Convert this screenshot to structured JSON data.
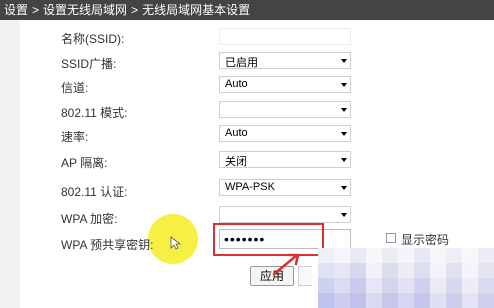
{
  "breadcrumb": {
    "items": [
      "设置",
      "设置无线局域网",
      "无线局域网基本设置"
    ],
    "separator": ">"
  },
  "form": {
    "ssid_label": "名称(SSID):",
    "ssid_value": "",
    "broadcast_label": "SSID广播:",
    "broadcast_value": "已启用",
    "channel_label": "信道:",
    "channel_value": "Auto",
    "mode_label": "802.11 模式:",
    "mode_value": "",
    "rate_label": "速率:",
    "rate_value": "Auto",
    "ap_isolation_label": "AP 隔离:",
    "ap_isolation_value": "关闭",
    "auth_label": "802.11 认证:",
    "auth_value": "WPA-PSK",
    "encryption_label": "WPA 加密:",
    "encryption_value": "",
    "psk_label": "WPA 预共享密钥:",
    "psk_value": "•••••••",
    "show_password_label": "显示密码",
    "show_password_checked": false,
    "apply_label": "应用"
  },
  "colors": {
    "topbar": "#444444",
    "highlight": "#d93030",
    "cursor_glow": "#f6ef3a"
  },
  "icons": {
    "cursor": "mouse-pointer-icon",
    "arrow": "red-arrow-annotation-icon"
  }
}
